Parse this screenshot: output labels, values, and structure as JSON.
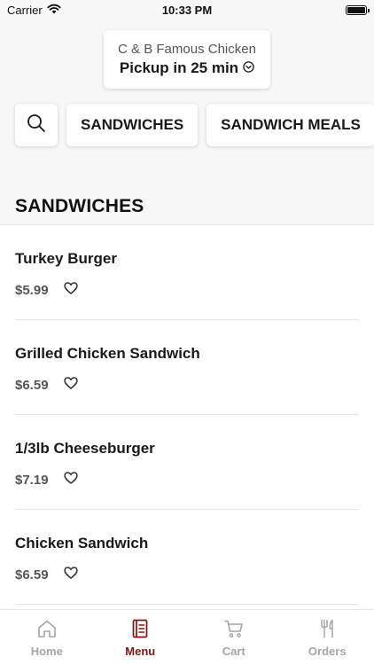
{
  "status_bar": {
    "carrier": "Carrier",
    "time": "10:33 PM"
  },
  "store": {
    "name": "C & B Famous Chicken",
    "pickup": "Pickup in 25 min"
  },
  "categories": [
    {
      "label": "SANDWICHES"
    },
    {
      "label": "SANDWICH MEALS"
    }
  ],
  "section": {
    "title": "SANDWICHES"
  },
  "items": [
    {
      "name": "Turkey Burger",
      "price": "$5.99"
    },
    {
      "name": "Grilled Chicken Sandwich",
      "price": "$6.59"
    },
    {
      "name": "1/3lb Cheeseburger",
      "price": "$7.19"
    },
    {
      "name": "Chicken Sandwich",
      "price": "$6.59"
    }
  ],
  "tabs": [
    {
      "label": "Home",
      "icon": "home-icon"
    },
    {
      "label": "Menu",
      "icon": "menu-icon"
    },
    {
      "label": "Cart",
      "icon": "cart-icon"
    },
    {
      "label": "Orders",
      "icon": "utensils-icon"
    }
  ],
  "colors": {
    "accent": "#7a1616",
    "inactive": "#a5a5a5"
  }
}
